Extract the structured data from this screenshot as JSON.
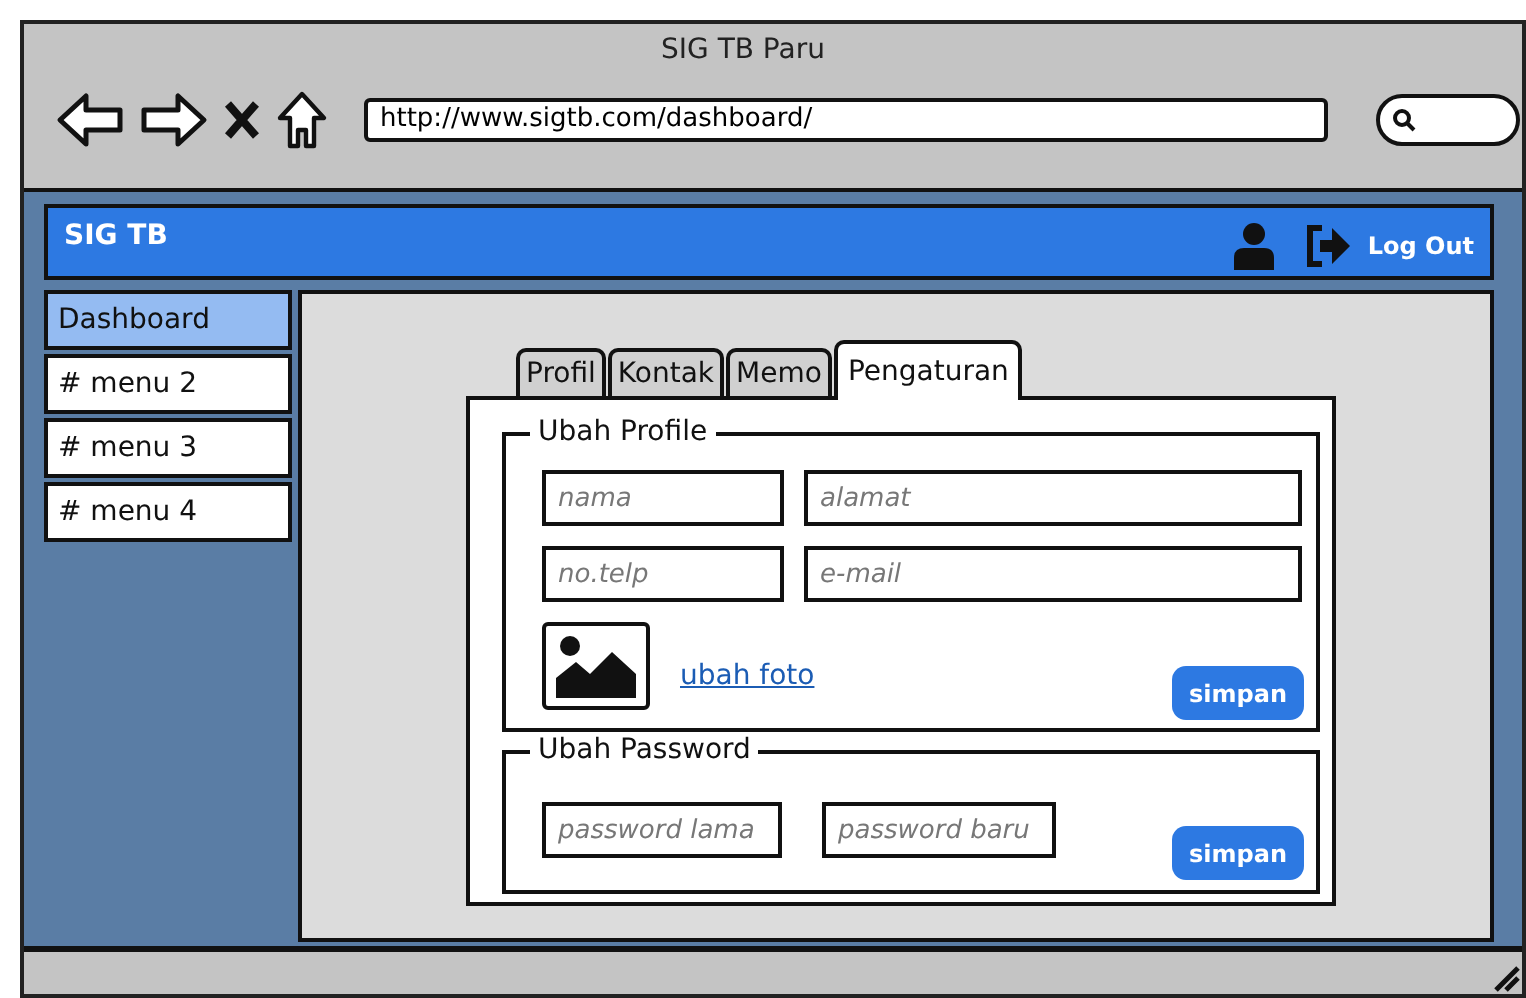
{
  "window": {
    "title": "SIG TB Paru",
    "url": "http://www.sigtb.com/dashboard/"
  },
  "header": {
    "brand": "SIG TB",
    "logout": "Log Out"
  },
  "sidebar": {
    "items": [
      {
        "label": "Dashboard",
        "selected": true
      },
      {
        "label": "# menu 2",
        "selected": false
      },
      {
        "label": "# menu 3",
        "selected": false
      },
      {
        "label": "# menu 4",
        "selected": false
      }
    ]
  },
  "tabs": [
    {
      "label": "Profil",
      "selected": false
    },
    {
      "label": "Kontak",
      "selected": false
    },
    {
      "label": "Memo",
      "selected": false
    },
    {
      "label": "Pengaturan",
      "selected": true
    }
  ],
  "profile_section": {
    "title": "Ubah Profile",
    "fields": [
      {
        "placeholder": "nama"
      },
      {
        "placeholder": "alamat"
      },
      {
        "placeholder": "no.telp"
      },
      {
        "placeholder": "e-mail"
      }
    ],
    "photo_link": "ubah foto",
    "save": "simpan"
  },
  "password_section": {
    "title": "Ubah Password",
    "fields": [
      {
        "placeholder": "password lama"
      },
      {
        "placeholder": "password baru"
      }
    ],
    "save": "simpan"
  }
}
